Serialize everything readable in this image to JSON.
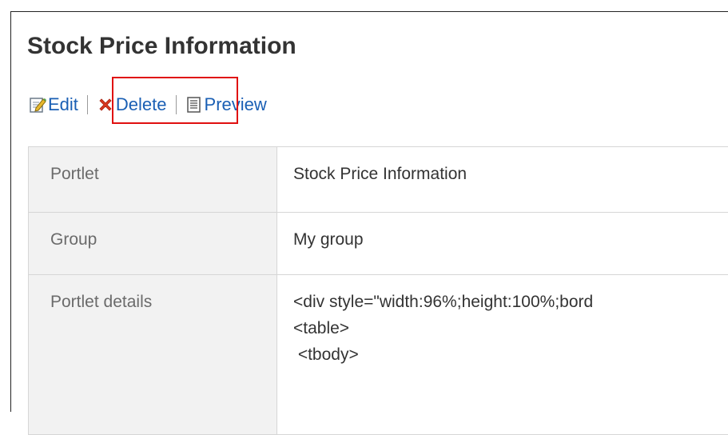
{
  "page": {
    "title": "Stock Price Information"
  },
  "toolbar": {
    "edit_label": "Edit",
    "delete_label": "Delete",
    "preview_label": "Preview"
  },
  "details": {
    "rows": [
      {
        "label": "Portlet",
        "value": "Stock Price Information"
      },
      {
        "label": "Group",
        "value": "My group"
      },
      {
        "label": "Portlet details",
        "code_lines": [
          "<div style=\"width:96%;height:100%;bord",
          "<table>",
          " <tbody>"
        ]
      }
    ]
  },
  "colors": {
    "link": "#1a5fb4",
    "highlight": "#e01010",
    "label_bg": "#f2f2f2",
    "border": "#d6d6d6"
  },
  "icons": {
    "edit": "edit-icon",
    "delete": "delete-x-icon",
    "preview": "preview-document-icon"
  }
}
